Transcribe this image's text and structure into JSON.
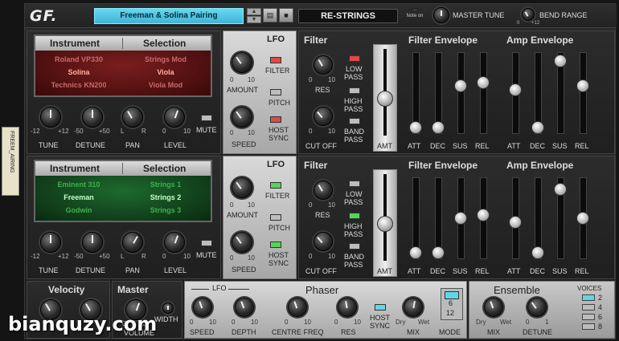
{
  "header": {
    "logo": "GF.",
    "patch_name": "Freeman & Solina Pairing",
    "device_name": "RE-STRINGS",
    "note_on": "Note on",
    "master_tune": "MASTER TUNE",
    "bend_range": "BEND RANGE",
    "bend_min": "0",
    "bend_max": "+12"
  },
  "side_tab": "FREEM_AIRING",
  "layers": [
    {
      "instrument_header": "Instrument",
      "selection_header": "Selection",
      "instruments": [
        "Roland VP330",
        "Solina",
        "Technics KN200"
      ],
      "selections": [
        "Strings Mod",
        "Viola",
        "Viola Mod"
      ],
      "selected_index": 1,
      "knobs": [
        {
          "label": "TUNE",
          "min": "-12",
          "max": "+12"
        },
        {
          "label": "DETUNE",
          "min": "-50",
          "max": "+50"
        },
        {
          "label": "PAN",
          "min": "L",
          "max": "R"
        },
        {
          "label": "LEVEL",
          "min": "0",
          "max": "10"
        }
      ],
      "mute": "MUTE",
      "lfo": {
        "title": "LFO",
        "amount": "AMOUNT",
        "speed": "SPEED",
        "min": "0",
        "max": "10",
        "filter": "FILTER",
        "pitch": "PITCH",
        "host_sync": [
          "HOST",
          "SYNC"
        ]
      },
      "filter": {
        "title": "Filter",
        "res": "RES",
        "cutoff": "CUT OFF",
        "low_pass": [
          "LOW",
          "PASS"
        ],
        "high_pass": [
          "HIGH",
          "PASS"
        ],
        "band_pass": [
          "BAND",
          "PASS"
        ],
        "amt": "AMT",
        "min": "0",
        "max": "10"
      },
      "filter_env": {
        "title": "Filter Envelope",
        "labels": [
          "ATT",
          "DEC",
          "SUS",
          "REL"
        ],
        "levels": [
          0.02,
          0.02,
          0.6,
          0.65
        ]
      },
      "amp_env": {
        "title": "Amp Envelope",
        "labels": [
          "ATT",
          "DEC",
          "SUS",
          "REL"
        ],
        "levels": [
          0.55,
          0.02,
          0.95,
          0.6
        ]
      }
    },
    {
      "instrument_header": "Instrument",
      "selection_header": "Selection",
      "instruments": [
        "Eminent 310",
        "Freeman",
        "Godwin"
      ],
      "selections": [
        "Strings 1",
        "Strings 2",
        "Strings 3"
      ],
      "selected_index": 1,
      "knobs": [
        {
          "label": "TUNE",
          "min": "-12",
          "max": "+12"
        },
        {
          "label": "DETUNE",
          "min": "-50",
          "max": "+50"
        },
        {
          "label": "PAN",
          "min": "L",
          "max": "R"
        },
        {
          "label": "LEVEL",
          "min": "0",
          "max": "10"
        }
      ],
      "mute": "MUTE",
      "lfo": {
        "title": "LFO",
        "amount": "AMOUNT",
        "speed": "SPEED",
        "min": "0",
        "max": "10",
        "filter": "FILTER",
        "pitch": "PITCH",
        "host_sync": [
          "HOST",
          "SYNC"
        ]
      },
      "filter": {
        "title": "Filter",
        "res": "RES",
        "cutoff": "CUT OFF",
        "low_pass": [
          "LOW",
          "PASS"
        ],
        "high_pass": [
          "HIGH",
          "PASS"
        ],
        "band_pass": [
          "BAND",
          "PASS"
        ],
        "amt": "AMT",
        "min": "0",
        "max": "10"
      },
      "filter_env": {
        "title": "Filter Envelope",
        "labels": [
          "ATT",
          "DEC",
          "SUS",
          "REL"
        ],
        "levels": [
          0.02,
          0.02,
          0.5,
          0.55
        ]
      },
      "amp_env": {
        "title": "Amp Envelope",
        "labels": [
          "ATT",
          "DEC",
          "SUS",
          "REL"
        ],
        "levels": [
          0.45,
          0.02,
          0.9,
          0.5
        ]
      }
    }
  ],
  "bottom": {
    "velocity": "Velocity",
    "master": "Master",
    "master_min": "0",
    "master_max": "10",
    "volume": "VOLUME",
    "width": "WIDTH",
    "phaser": "Phaser",
    "phaser_lfo": "LFO",
    "speed": "SPEED",
    "depth": "DEPTH",
    "centre_freq": "CENTRE FREQ",
    "res": "RES",
    "host_sync": [
      "HOST",
      "SYNC"
    ],
    "mix": "MIX",
    "dry": "Dry",
    "wet": "Wet",
    "mode": "MODE",
    "modes": [
      "6",
      "12"
    ],
    "knob_min": "0",
    "knob_max": "10",
    "ensemble": "Ensemble",
    "ens_mix": "MIX",
    "detune": "DETUNE",
    "detune_min": "0",
    "detune_max": "1",
    "voices": "VOICES",
    "voice_options": [
      "2",
      "4",
      "6",
      "8"
    ],
    "voice_selected": "2"
  },
  "watermark": "bianquzy.com"
}
